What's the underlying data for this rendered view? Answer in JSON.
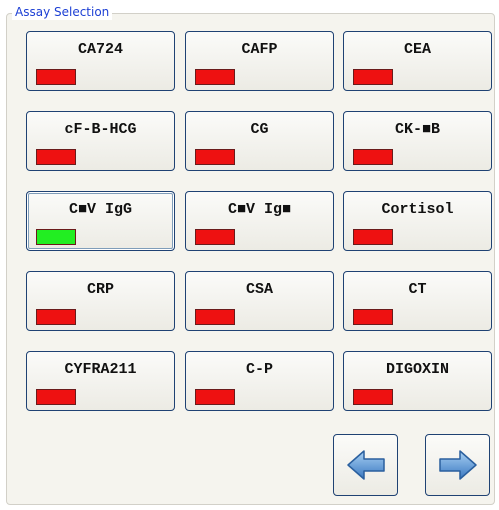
{
  "group": {
    "title": "Assay Selection"
  },
  "assays": [
    {
      "label": "CA724",
      "status_color": "#ee1111",
      "selected": false
    },
    {
      "label": "CAFP",
      "status_color": "#ee1111",
      "selected": false
    },
    {
      "label": "CEA",
      "status_color": "#ee1111",
      "selected": false
    },
    {
      "label": "cF-B-HCG",
      "status_color": "#ee1111",
      "selected": false
    },
    {
      "label": "CG",
      "status_color": "#ee1111",
      "selected": false
    },
    {
      "label": "CK-■B",
      "status_color": "#ee1111",
      "selected": false
    },
    {
      "label": "C■V IgG",
      "status_color": "#22ee22",
      "selected": true
    },
    {
      "label": "C■V Ig■",
      "status_color": "#ee1111",
      "selected": false
    },
    {
      "label": "Cortisol",
      "status_color": "#ee1111",
      "selected": false
    },
    {
      "label": "CRP",
      "status_color": "#ee1111",
      "selected": false
    },
    {
      "label": "CSA",
      "status_color": "#ee1111",
      "selected": false
    },
    {
      "label": "CT",
      "status_color": "#ee1111",
      "selected": false
    },
    {
      "label": "CYFRA211",
      "status_color": "#ee1111",
      "selected": false
    },
    {
      "label": "C-P",
      "status_color": "#ee1111",
      "selected": false
    },
    {
      "label": "DIGOXIN",
      "status_color": "#ee1111",
      "selected": false
    }
  ],
  "nav": {
    "prev_icon": "arrow-left-icon",
    "next_icon": "arrow-right-icon",
    "arrow_color": "#4a86c8"
  }
}
